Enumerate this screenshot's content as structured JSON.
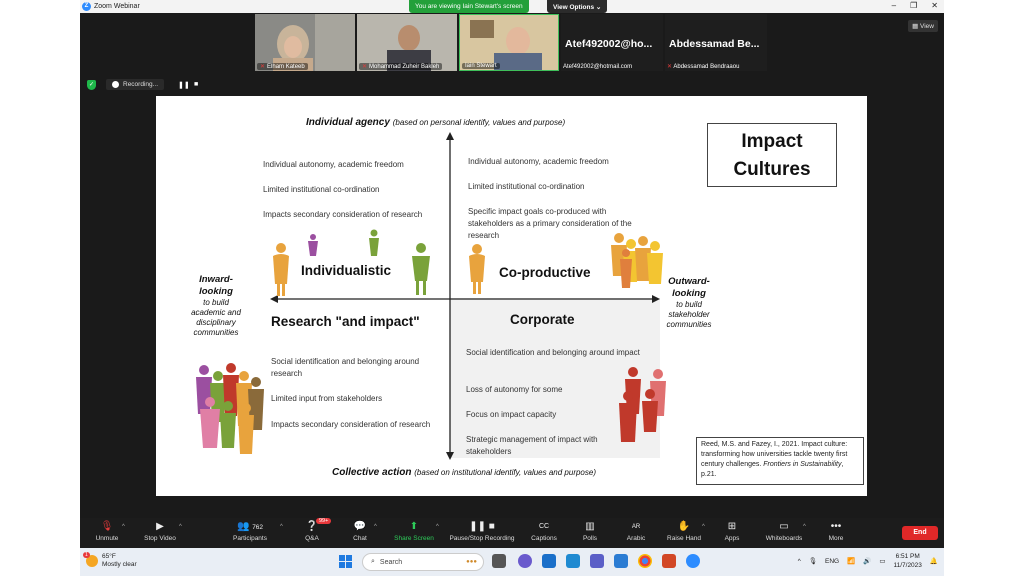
{
  "window": {
    "app_title": "Zoom Webinar",
    "viewing_banner": "You are viewing Iain Stewart's screen",
    "view_options": "View Options",
    "controls": [
      "–",
      "❐",
      "✕"
    ]
  },
  "participants_strip": {
    "tiles": [
      {
        "name": "Elham Kateeb"
      },
      {
        "name": "Mohammad Zuheir Bakleh"
      },
      {
        "name": "Iain Stewart"
      }
    ],
    "name_tiles": [
      {
        "big": "Atef492002@ho...",
        "small": "Atef492002@hotmail.com"
      },
      {
        "big": "Abdessamad  Be...",
        "small": "Abdessamad Bendraaou"
      }
    ],
    "view_button": "View"
  },
  "recording": {
    "label": "Recording...",
    "pause": "❚❚",
    "stop": "■"
  },
  "slide": {
    "top_axis": {
      "bold": "Individual agency",
      "normal": "(based on personal identify, values and purpose)"
    },
    "bottom_axis": {
      "bold": "Collective action",
      "normal": "(based on institutional identify, values and purpose)"
    },
    "left_side": {
      "title": "Inward-looking",
      "sub": "to build academic and disciplinary communities"
    },
    "right_side": {
      "title": "Outward-looking",
      "sub": "to build stakeholder communities"
    },
    "title_box": {
      "line1": "Impact",
      "line2": "Cultures"
    },
    "quadrants": {
      "top_left": {
        "label": "Individualistic",
        "points": [
          "Individual autonomy, academic freedom",
          "Limited institutional co-ordination",
          "Impacts secondary consideration of research"
        ]
      },
      "top_right": {
        "label": "Co-productive",
        "points": [
          "Individual autonomy, academic freedom",
          "Limited institutional co-ordination",
          "Specific impact goals co-produced with stakeholders as a primary consideration of the research"
        ]
      },
      "bottom_left": {
        "label": "Research \"and impact\"",
        "points": [
          "Social identification and belonging around research",
          "Limited input from stakeholders",
          "Impacts secondary consideration of research"
        ]
      },
      "bottom_right": {
        "label": "Corporate",
        "points": [
          "Social identification and belonging around impact",
          "Loss of autonomy for some",
          "Focus on impact capacity",
          "Strategic management of impact with stakeholders"
        ]
      }
    },
    "reference": {
      "text": "Reed, M.S. and Fazey, I., 2021. Impact culture: transforming how universities tackle twenty first century challenges.",
      "journal": "Frontiers in Sustainability",
      "page": ", p.21."
    },
    "figure_colors": {
      "orange": "#e8a33d",
      "green": "#7aa23a",
      "purple": "#9b4fa0",
      "red": "#c0392b",
      "pink": "#e07fa5",
      "yellow": "#f3c531"
    }
  },
  "toolbar": {
    "items": [
      {
        "label": "Unmute",
        "icon": "🎙"
      },
      {
        "label": "Stop Video",
        "icon": "▶"
      },
      {
        "label": "Participants",
        "icon": "👥",
        "count": "762"
      },
      {
        "label": "Q&A",
        "icon": "❔",
        "badge": "99+"
      },
      {
        "label": "Chat",
        "icon": "💬"
      },
      {
        "label": "Share Screen",
        "icon": "⬆"
      },
      {
        "label": "Pause/Stop Recording",
        "icon": "❚❚ ■"
      },
      {
        "label": "Captions",
        "icon": "CC"
      },
      {
        "label": "Polls",
        "icon": "▥"
      },
      {
        "label": "Arabic",
        "icon": "AR"
      },
      {
        "label": "Raise Hand",
        "icon": "✋"
      },
      {
        "label": "Apps",
        "icon": "⊞"
      },
      {
        "label": "Whiteboards",
        "icon": "▭"
      },
      {
        "label": "More",
        "icon": "•••"
      }
    ],
    "end": "End"
  },
  "taskbar": {
    "weather_temp": "65°F",
    "weather_desc": "Mostly clear",
    "search_placeholder": "Search",
    "tray_lang": "ENG",
    "time": "6:51 PM",
    "date": "11/7/2023",
    "notification_count": "1"
  }
}
